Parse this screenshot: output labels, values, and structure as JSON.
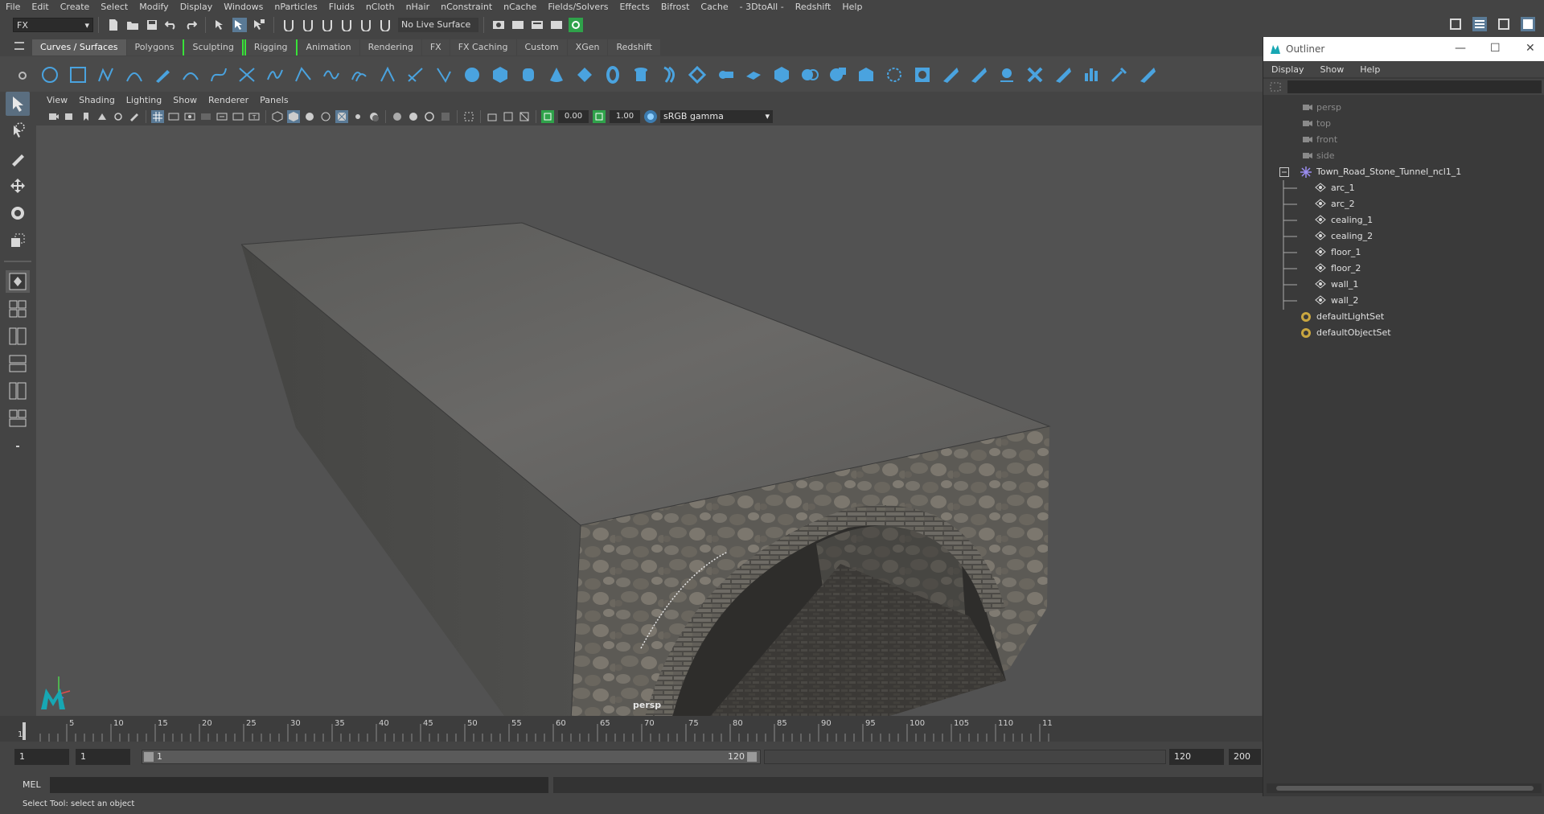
{
  "menubar": [
    "File",
    "Edit",
    "Create",
    "Select",
    "Modify",
    "Display",
    "Windows",
    "nParticles",
    "Fluids",
    "nCloth",
    "nHair",
    "nConstraint",
    "nCache",
    "Fields/Solvers",
    "Effects",
    "Bifrost",
    "Cache",
    "- 3DtoAll -",
    "Redshift",
    "Help"
  ],
  "statusline": {
    "menuset": "FX",
    "live_surface": "No Live Surface"
  },
  "shelf": {
    "tabs": [
      "Curves / Surfaces",
      "Polygons",
      "Sculpting",
      "Rigging",
      "Animation",
      "Rendering",
      "FX",
      "FX Caching",
      "Custom",
      "XGen",
      "Redshift"
    ],
    "active_tab": "Curves / Surfaces"
  },
  "viewport": {
    "menu": [
      "View",
      "Shading",
      "Lighting",
      "Show",
      "Renderer",
      "Panels"
    ],
    "exposure": "0.00",
    "gamma": "1.00",
    "colorspace": "sRGB gamma",
    "camera": "persp"
  },
  "timeline": {
    "ticks": [
      "5",
      "10",
      "15",
      "20",
      "25",
      "30",
      "35",
      "40",
      "45",
      "50",
      "55",
      "60",
      "65",
      "70",
      "75",
      "80",
      "85",
      "90",
      "95",
      "100",
      "105",
      "110",
      "11"
    ],
    "current_frame": "1",
    "range_start": "1",
    "playback_start": "1",
    "range_bar_start": "1",
    "range_bar_end": "120",
    "playback_end": "120",
    "range_end": "200"
  },
  "cmdline": {
    "label": "MEL"
  },
  "helpline": "Select Tool: select an object",
  "outliner": {
    "title": "Outliner",
    "menu": [
      "Display",
      "Show",
      "Help"
    ],
    "cameras": [
      "persp",
      "top",
      "front",
      "side"
    ],
    "group": "Town_Road_Stone_Tunnel_ncl1_1",
    "children": [
      "arc_1",
      "arc_2",
      "cealing_1",
      "cealing_2",
      "floor_1",
      "floor_2",
      "wall_1",
      "wall_2"
    ],
    "sets": [
      "defaultLightSet",
      "defaultObjectSet"
    ]
  }
}
